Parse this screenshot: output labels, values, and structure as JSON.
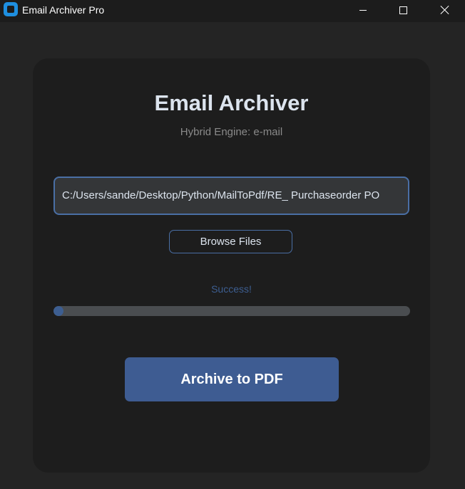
{
  "window": {
    "title": "Email Archiver Pro",
    "icon": "app-icon"
  },
  "main": {
    "title": "Email Archiver",
    "subtitle": "Hybrid Engine: e-mail",
    "file_path": "C:/Users/sande/Desktop/Python/MailToPdf/RE_ Purchaseorder PO",
    "browse_label": "Browse Files",
    "status": "Success!",
    "progress": 0.02,
    "archive_label": "Archive to PDF"
  },
  "colors": {
    "background": "#242424",
    "card": "#1d1d1d",
    "accent": "#3e5c92",
    "border_accent": "#4a6fa5",
    "status": "#3d5e91"
  }
}
